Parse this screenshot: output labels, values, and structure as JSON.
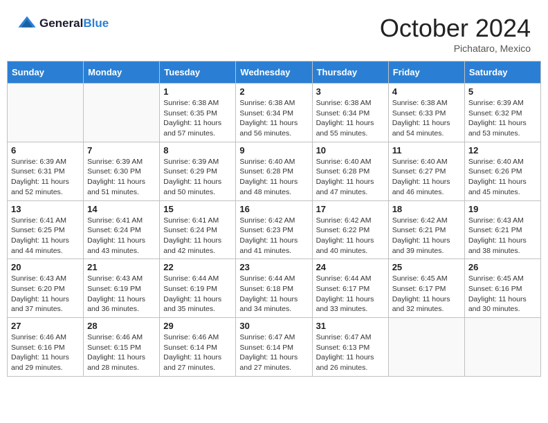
{
  "header": {
    "logo_line1": "General",
    "logo_line2": "Blue",
    "month": "October 2024",
    "location": "Pichataro, Mexico"
  },
  "weekdays": [
    "Sunday",
    "Monday",
    "Tuesday",
    "Wednesday",
    "Thursday",
    "Friday",
    "Saturday"
  ],
  "weeks": [
    [
      {
        "day": "",
        "info": ""
      },
      {
        "day": "",
        "info": ""
      },
      {
        "day": "1",
        "sunrise": "6:38 AM",
        "sunset": "6:35 PM",
        "daylight": "11 hours and 57 minutes."
      },
      {
        "day": "2",
        "sunrise": "6:38 AM",
        "sunset": "6:34 PM",
        "daylight": "11 hours and 56 minutes."
      },
      {
        "day": "3",
        "sunrise": "6:38 AM",
        "sunset": "6:34 PM",
        "daylight": "11 hours and 55 minutes."
      },
      {
        "day": "4",
        "sunrise": "6:38 AM",
        "sunset": "6:33 PM",
        "daylight": "11 hours and 54 minutes."
      },
      {
        "day": "5",
        "sunrise": "6:39 AM",
        "sunset": "6:32 PM",
        "daylight": "11 hours and 53 minutes."
      }
    ],
    [
      {
        "day": "6",
        "sunrise": "6:39 AM",
        "sunset": "6:31 PM",
        "daylight": "11 hours and 52 minutes."
      },
      {
        "day": "7",
        "sunrise": "6:39 AM",
        "sunset": "6:30 PM",
        "daylight": "11 hours and 51 minutes."
      },
      {
        "day": "8",
        "sunrise": "6:39 AM",
        "sunset": "6:29 PM",
        "daylight": "11 hours and 50 minutes."
      },
      {
        "day": "9",
        "sunrise": "6:40 AM",
        "sunset": "6:28 PM",
        "daylight": "11 hours and 48 minutes."
      },
      {
        "day": "10",
        "sunrise": "6:40 AM",
        "sunset": "6:28 PM",
        "daylight": "11 hours and 47 minutes."
      },
      {
        "day": "11",
        "sunrise": "6:40 AM",
        "sunset": "6:27 PM",
        "daylight": "11 hours and 46 minutes."
      },
      {
        "day": "12",
        "sunrise": "6:40 AM",
        "sunset": "6:26 PM",
        "daylight": "11 hours and 45 minutes."
      }
    ],
    [
      {
        "day": "13",
        "sunrise": "6:41 AM",
        "sunset": "6:25 PM",
        "daylight": "11 hours and 44 minutes."
      },
      {
        "day": "14",
        "sunrise": "6:41 AM",
        "sunset": "6:24 PM",
        "daylight": "11 hours and 43 minutes."
      },
      {
        "day": "15",
        "sunrise": "6:41 AM",
        "sunset": "6:24 PM",
        "daylight": "11 hours and 42 minutes."
      },
      {
        "day": "16",
        "sunrise": "6:42 AM",
        "sunset": "6:23 PM",
        "daylight": "11 hours and 41 minutes."
      },
      {
        "day": "17",
        "sunrise": "6:42 AM",
        "sunset": "6:22 PM",
        "daylight": "11 hours and 40 minutes."
      },
      {
        "day": "18",
        "sunrise": "6:42 AM",
        "sunset": "6:21 PM",
        "daylight": "11 hours and 39 minutes."
      },
      {
        "day": "19",
        "sunrise": "6:43 AM",
        "sunset": "6:21 PM",
        "daylight": "11 hours and 38 minutes."
      }
    ],
    [
      {
        "day": "20",
        "sunrise": "6:43 AM",
        "sunset": "6:20 PM",
        "daylight": "11 hours and 37 minutes."
      },
      {
        "day": "21",
        "sunrise": "6:43 AM",
        "sunset": "6:19 PM",
        "daylight": "11 hours and 36 minutes."
      },
      {
        "day": "22",
        "sunrise": "6:44 AM",
        "sunset": "6:19 PM",
        "daylight": "11 hours and 35 minutes."
      },
      {
        "day": "23",
        "sunrise": "6:44 AM",
        "sunset": "6:18 PM",
        "daylight": "11 hours and 34 minutes."
      },
      {
        "day": "24",
        "sunrise": "6:44 AM",
        "sunset": "6:17 PM",
        "daylight": "11 hours and 33 minutes."
      },
      {
        "day": "25",
        "sunrise": "6:45 AM",
        "sunset": "6:17 PM",
        "daylight": "11 hours and 32 minutes."
      },
      {
        "day": "26",
        "sunrise": "6:45 AM",
        "sunset": "6:16 PM",
        "daylight": "11 hours and 30 minutes."
      }
    ],
    [
      {
        "day": "27",
        "sunrise": "6:46 AM",
        "sunset": "6:16 PM",
        "daylight": "11 hours and 29 minutes."
      },
      {
        "day": "28",
        "sunrise": "6:46 AM",
        "sunset": "6:15 PM",
        "daylight": "11 hours and 28 minutes."
      },
      {
        "day": "29",
        "sunrise": "6:46 AM",
        "sunset": "6:14 PM",
        "daylight": "11 hours and 27 minutes."
      },
      {
        "day": "30",
        "sunrise": "6:47 AM",
        "sunset": "6:14 PM",
        "daylight": "11 hours and 27 minutes."
      },
      {
        "day": "31",
        "sunrise": "6:47 AM",
        "sunset": "6:13 PM",
        "daylight": "11 hours and 26 minutes."
      },
      {
        "day": "",
        "info": ""
      },
      {
        "day": "",
        "info": ""
      }
    ]
  ]
}
